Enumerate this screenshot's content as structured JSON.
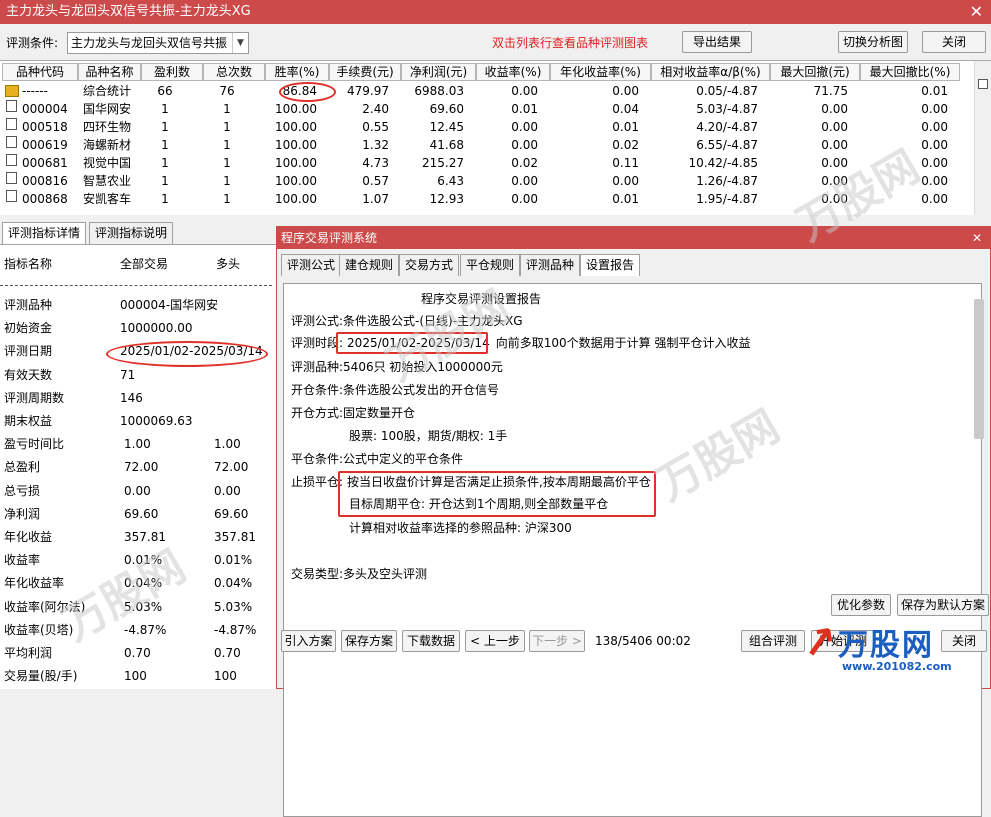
{
  "window": {
    "title": "主力龙头与龙回头双信号共振-主力龙头XG",
    "close": "✕"
  },
  "toolbar": {
    "condition_label": "评测条件:",
    "condition_value": "主力龙头与龙回头双信号共振",
    "hint": "双击列表行查看品种评测图表",
    "export": "导出结果",
    "switch": "切换分析图",
    "close": "关闭"
  },
  "grid": {
    "headers": [
      "品种代码",
      "品种名称",
      "盈利数",
      "总次数",
      "胜率(%)",
      "手续费(元)",
      "净利润(元)",
      "收益率(%)",
      "年化收益率(%)",
      "相对收益率α/β(%)",
      "最大回撤(元)",
      "最大回撤比(%)"
    ],
    "rows": [
      [
        "------",
        "综合统计",
        "66",
        "76",
        "86.84",
        "479.97",
        "6988.03",
        "0.00",
        "0.00",
        "0.05/-4.87",
        "71.75",
        "0.01"
      ],
      [
        "000004",
        "国华网安",
        "1",
        "1",
        "100.00",
        "2.40",
        "69.60",
        "0.01",
        "0.04",
        "5.03/-4.87",
        "0.00",
        "0.00"
      ],
      [
        "000518",
        "四环生物",
        "1",
        "1",
        "100.00",
        "0.55",
        "12.45",
        "0.00",
        "0.01",
        "4.20/-4.87",
        "0.00",
        "0.00"
      ],
      [
        "000619",
        "海螺新材",
        "1",
        "1",
        "100.00",
        "1.32",
        "41.68",
        "0.00",
        "0.02",
        "6.55/-4.87",
        "0.00",
        "0.00"
      ],
      [
        "000681",
        "视觉中国",
        "1",
        "1",
        "100.00",
        "4.73",
        "215.27",
        "0.02",
        "0.11",
        "10.42/-4.85",
        "0.00",
        "0.00"
      ],
      [
        "000816",
        "智慧农业",
        "1",
        "1",
        "100.00",
        "0.57",
        "6.43",
        "0.00",
        "0.00",
        "1.26/-4.87",
        "0.00",
        "0.00"
      ],
      [
        "000868",
        "安凯客车",
        "1",
        "1",
        "100.00",
        "1.07",
        "12.93",
        "0.00",
        "0.01",
        "1.95/-4.87",
        "0.00",
        "0.00"
      ]
    ]
  },
  "left": {
    "tabs": [
      "评测指标详情",
      "评测指标说明"
    ],
    "head": [
      "指标名称",
      "全部交易",
      "多头"
    ],
    "rows": [
      [
        "评测品种",
        "000004-国华网安",
        ""
      ],
      [
        "初始资金",
        "1000000.00",
        ""
      ],
      [
        "评测日期",
        "2025/01/02-2025/03/14",
        ""
      ],
      [
        "有效天数",
        "71",
        ""
      ],
      [
        "评测周期数",
        "146",
        ""
      ],
      [
        "期末权益",
        "1000069.63",
        ""
      ],
      [
        "盈亏时间比",
        "1.00",
        "1.00"
      ],
      [
        "总盈利",
        "72.00",
        "72.00"
      ],
      [
        "总亏损",
        "0.00",
        "0.00"
      ],
      [
        "净利润",
        "69.60",
        "69.60"
      ],
      [
        "年化收益",
        "357.81",
        "357.81"
      ],
      [
        "收益率",
        "0.01%",
        "0.01%"
      ],
      [
        "年化收益率",
        "0.04%",
        "0.04%"
      ],
      [
        "收益率(阿尔法)",
        "5.03%",
        "5.03%"
      ],
      [
        "收益率(贝塔)",
        "-4.87%",
        "-4.87%"
      ],
      [
        "平均利润",
        "0.70",
        "0.70"
      ],
      [
        "交易量(股/手)",
        "100",
        "100"
      ]
    ]
  },
  "dialog": {
    "title": "程序交易评测系统",
    "tabs": [
      "评测公式",
      "建仓规则",
      "交易方式",
      "平仓规则",
      "评测品种",
      "设置报告"
    ],
    "report_title": "程序交易评测设置报告",
    "lines": {
      "formula_k": "评测公式:",
      "formula_v": "条件选股公式-(日线)-主力龙头XG",
      "period_k": "评测时段:",
      "period_v": "2025/01/02-2025/03/14",
      "period_note": "向前多取100个数据用于计算 强制平仓计入收益",
      "variety_k": "评测品种:",
      "variety_v": "5406只 初始投入1000000元",
      "open_k": "开仓条件:",
      "open_v": "条件选股公式发出的开仓信号",
      "mode_k": "开仓方式:",
      "mode_v": "固定数量开仓",
      "mode2": "股票: 100股，期货/期权: 1手",
      "close_k": "平仓条件:",
      "close_v": "公式中定义的平仓条件",
      "stop_k": "止损平仓:",
      "stop_v": "按当日收盘价计算是否满足止损条件,按本周期最高价平仓",
      "target_v": "目标周期平仓: 开仓达到1个周期,则全部数量平仓",
      "bench": "计算相对收益率选择的参照品种: 沪深300",
      "type_k": "交易类型:",
      "type_v": "多头及空头评测"
    },
    "buttons": {
      "optimize": "优化参数",
      "save_default": "保存为默认方案",
      "import": "引入方案",
      "save": "保存方案",
      "download": "下载数据",
      "prev": "< 上一步",
      "next": "下一步 >",
      "progress": "138/5406 00:02",
      "combo": "组合评测",
      "start": "开始评测",
      "close": "关闭"
    }
  },
  "watermark": {
    "brand": "万股网",
    "url": "www.201082.com"
  }
}
